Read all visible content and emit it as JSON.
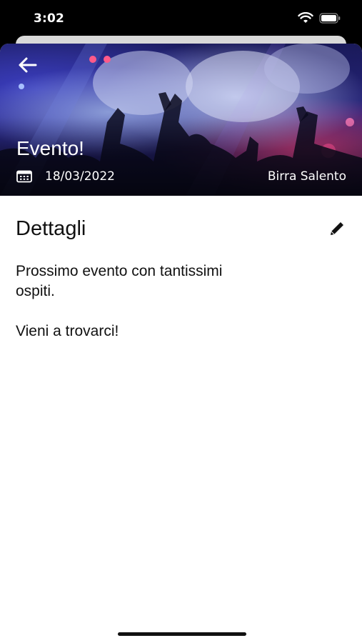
{
  "status": {
    "time": "3:02"
  },
  "hero": {
    "title": "Evento!",
    "date": "18/03/2022",
    "venue": "Birra Salento"
  },
  "details": {
    "heading": "Dettagli",
    "description": [
      "Prossimo evento con tantissimi ospiti.",
      "Vieni a trovarci!"
    ]
  },
  "icons": {
    "back": "arrow-left-icon",
    "calendar": "calendar-icon",
    "edit": "pencil-icon",
    "wifi": "wifi-icon",
    "battery": "battery-icon"
  },
  "colors": {
    "background": "#ffffff",
    "text": "#111111",
    "hero_text": "#ffffff"
  }
}
